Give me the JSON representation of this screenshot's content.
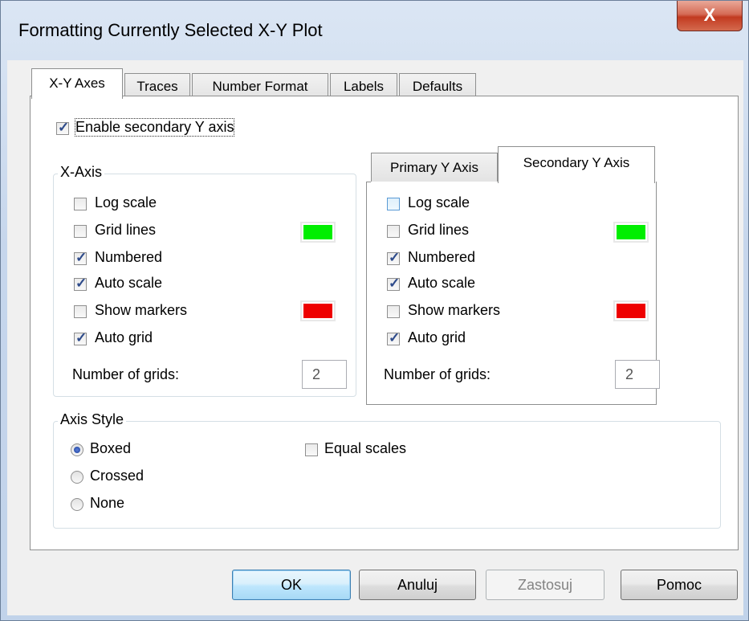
{
  "window": {
    "title": "Formatting Currently Selected X-Y Plot",
    "close_glyph": "X"
  },
  "tabs": [
    {
      "label": "X-Y Axes",
      "active": true
    },
    {
      "label": "Traces",
      "active": false
    },
    {
      "label": "Number Format",
      "active": false
    },
    {
      "label": "Labels",
      "active": false
    },
    {
      "label": "Defaults",
      "active": false
    }
  ],
  "secondary_y": {
    "label": "Enable secondary Y axis",
    "checked": true
  },
  "x_axis": {
    "title": "X-Axis",
    "log_scale": "Log scale",
    "grid_lines": "Grid lines",
    "numbered": "Numbered",
    "auto_scale": "Auto scale",
    "show_markers": "Show markers",
    "auto_grid": "Auto grid",
    "number_of_grids_label": "Number of grids:",
    "number_of_grids_value": "2",
    "grid_color": "#00ee00",
    "marker_color": "#ee0000"
  },
  "y_tabs": [
    {
      "label": "Primary Y Axis",
      "active": false
    },
    {
      "label": "Secondary Y Axis",
      "active": true
    }
  ],
  "y_axis": {
    "log_scale": "Log scale",
    "grid_lines": "Grid lines",
    "numbered": "Numbered",
    "auto_scale": "Auto scale",
    "show_markers": "Show markers",
    "auto_grid": "Auto grid",
    "number_of_grids_label": "Number of grids:",
    "number_of_grids_value": "2",
    "grid_color": "#00ee00",
    "marker_color": "#ee0000"
  },
  "axis_style": {
    "title": "Axis Style",
    "boxed": "Boxed",
    "crossed": "Crossed",
    "none": "None",
    "equal_scales": "Equal scales",
    "selected": "Boxed"
  },
  "buttons": {
    "ok": "OK",
    "cancel": "Anuluj",
    "apply": "Zastosuj",
    "help": "Pomoc"
  }
}
